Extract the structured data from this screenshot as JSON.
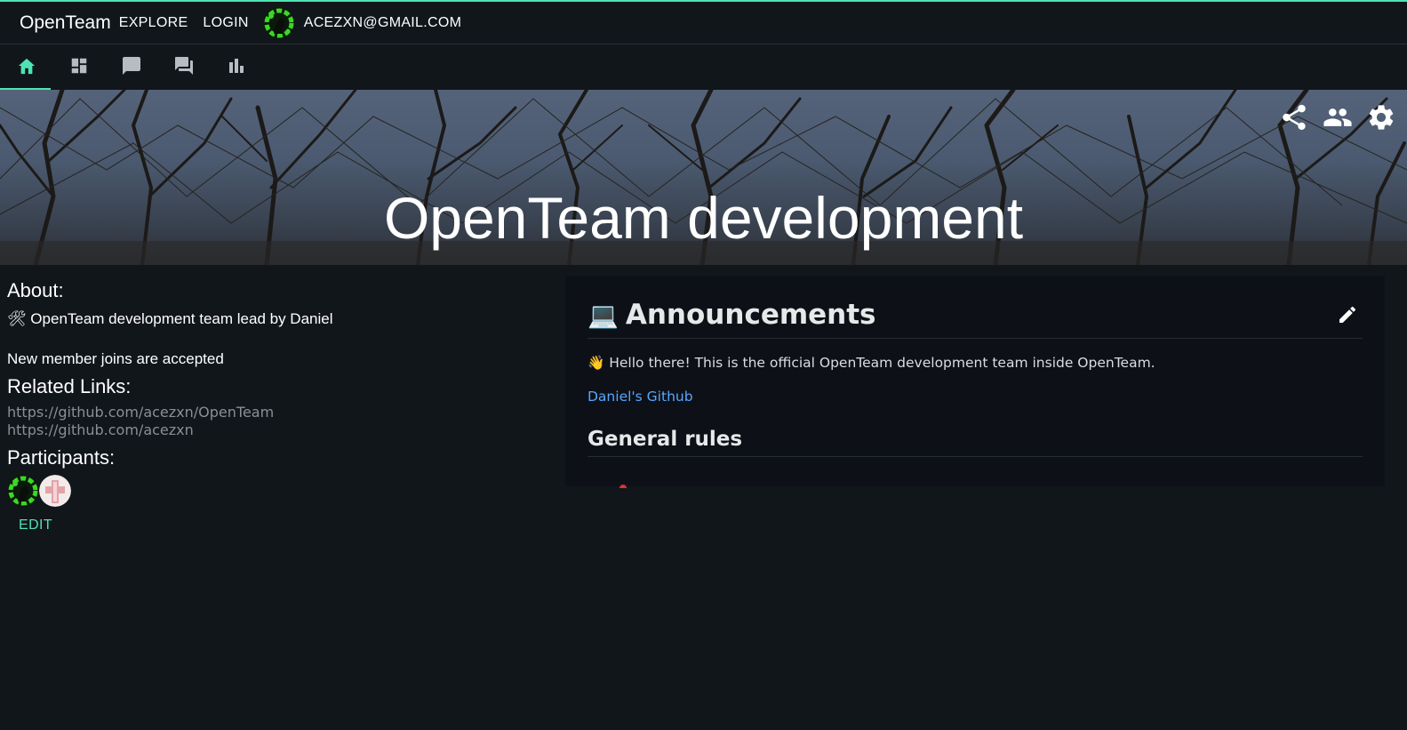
{
  "topbar": {
    "brand": "OpenTeam",
    "explore": "EXPLORE",
    "login": "LOGIN",
    "user_email": "ACEZXN@GMAIL.COM",
    "accent_color": "#4fe3b4"
  },
  "tabs": [
    {
      "name": "home-icon",
      "active": true
    },
    {
      "name": "dashboard-icon",
      "active": false
    },
    {
      "name": "chat-icon",
      "active": false
    },
    {
      "name": "forum-icon",
      "active": false
    },
    {
      "name": "bar-chart-icon",
      "active": false
    }
  ],
  "banner": {
    "title": "OpenTeam development",
    "actions": [
      "share-icon",
      "people-icon",
      "settings-icon"
    ]
  },
  "about": {
    "heading": "About:",
    "description": "🛠 OpenTeam development team lead by Daniel",
    "join_policy": "New member joins are accepted"
  },
  "related_links": {
    "heading": "Related Links:",
    "links": [
      "https://github.com/acezxn/OpenTeam",
      "https://github.com/acezxn"
    ]
  },
  "participants": {
    "heading": "Participants:",
    "edit_label": "EDIT"
  },
  "announcements": {
    "emoji": "💻",
    "title": "Announcements",
    "body": "👋 Hello there! This is the official OpenTeam development team inside OpenTeam.",
    "link_text": "Daniel's Github",
    "section_title": "General rules",
    "link_color": "#58a6ff"
  }
}
